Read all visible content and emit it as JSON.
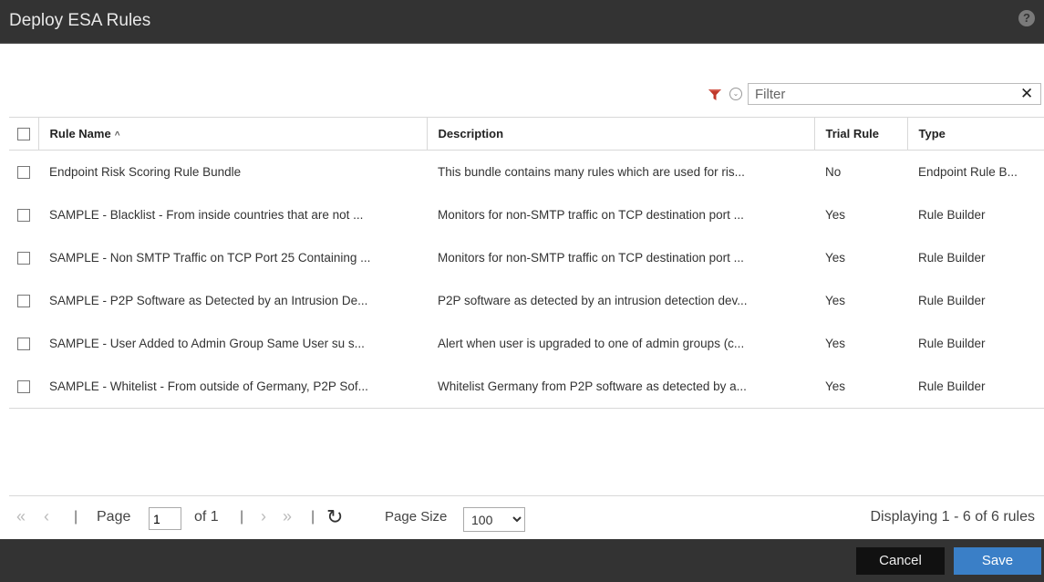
{
  "dialog": {
    "title": "Deploy ESA Rules"
  },
  "filter": {
    "placeholder": "Filter",
    "clear_glyph": "✕"
  },
  "table": {
    "headers": {
      "rule_name": "Rule Name",
      "description": "Description",
      "trial_rule": "Trial Rule",
      "type": "Type"
    },
    "sort_indicator": "^",
    "rows": [
      {
        "name": "Endpoint Risk Scoring Rule Bundle",
        "description": "This bundle contains many rules which are used for ris...",
        "trial": "No",
        "type": "Endpoint Rule B..."
      },
      {
        "name": "SAMPLE - Blacklist - From inside countries that are not ...",
        "description": "Monitors for non-SMTP traffic on TCP destination port ...",
        "trial": "Yes",
        "type": "Rule Builder"
      },
      {
        "name": "SAMPLE - Non SMTP Traffic on TCP Port 25 Containing ...",
        "description": "Monitors for non-SMTP traffic on TCP destination port ...",
        "trial": "Yes",
        "type": "Rule Builder"
      },
      {
        "name": "SAMPLE - P2P Software as Detected by an Intrusion De...",
        "description": "P2P software as detected by an intrusion detection dev...",
        "trial": "Yes",
        "type": "Rule Builder"
      },
      {
        "name": "SAMPLE - User Added to Admin Group Same User su s...",
        "description": "Alert when user is upgraded to one of admin groups (c...",
        "trial": "Yes",
        "type": "Rule Builder"
      },
      {
        "name": "SAMPLE - Whitelist - From outside of Germany, P2P Sof...",
        "description": "Whitelist Germany from P2P software as detected by a...",
        "trial": "Yes",
        "type": "Rule Builder"
      }
    ]
  },
  "pager": {
    "page_label": "Page",
    "page_value": "1",
    "of_label": "of 1",
    "page_size_label": "Page Size",
    "page_size_value": "100",
    "display_text": "Displaying 1 - 6 of 6 rules"
  },
  "footer": {
    "cancel_label": "Cancel",
    "save_label": "Save"
  },
  "colors": {
    "titlebar": "#333333",
    "save_button": "#3a7fc7",
    "filter_icon": "#c0392b"
  }
}
